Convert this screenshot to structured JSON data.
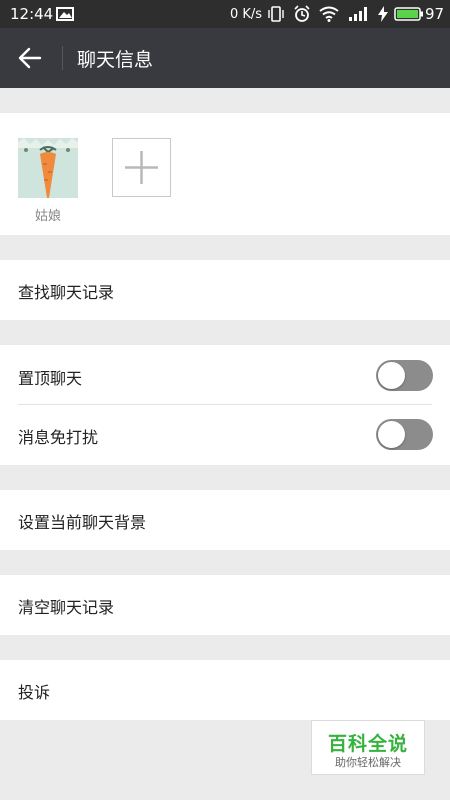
{
  "status_bar": {
    "time": "12:44",
    "net_speed": "0 K/s",
    "battery": "97"
  },
  "header": {
    "title": "聊天信息"
  },
  "members": [
    {
      "name": "姑娘"
    }
  ],
  "menu": {
    "search_history": "查找聊天记录",
    "pin_chat": {
      "label": "置顶聊天",
      "on": false
    },
    "mute": {
      "label": "消息免打扰",
      "on": false
    },
    "set_background": "设置当前聊天背景",
    "clear_history": "清空聊天记录",
    "report": "投诉"
  },
  "watermark": {
    "title": "百科全说",
    "subtitle": "助你轻松解决"
  },
  "colors": {
    "status_bar": "#2e2e2e",
    "app_bar": "#393a3f",
    "switch_off": "#8c8c8c",
    "watermark_green": "#35b33c"
  }
}
